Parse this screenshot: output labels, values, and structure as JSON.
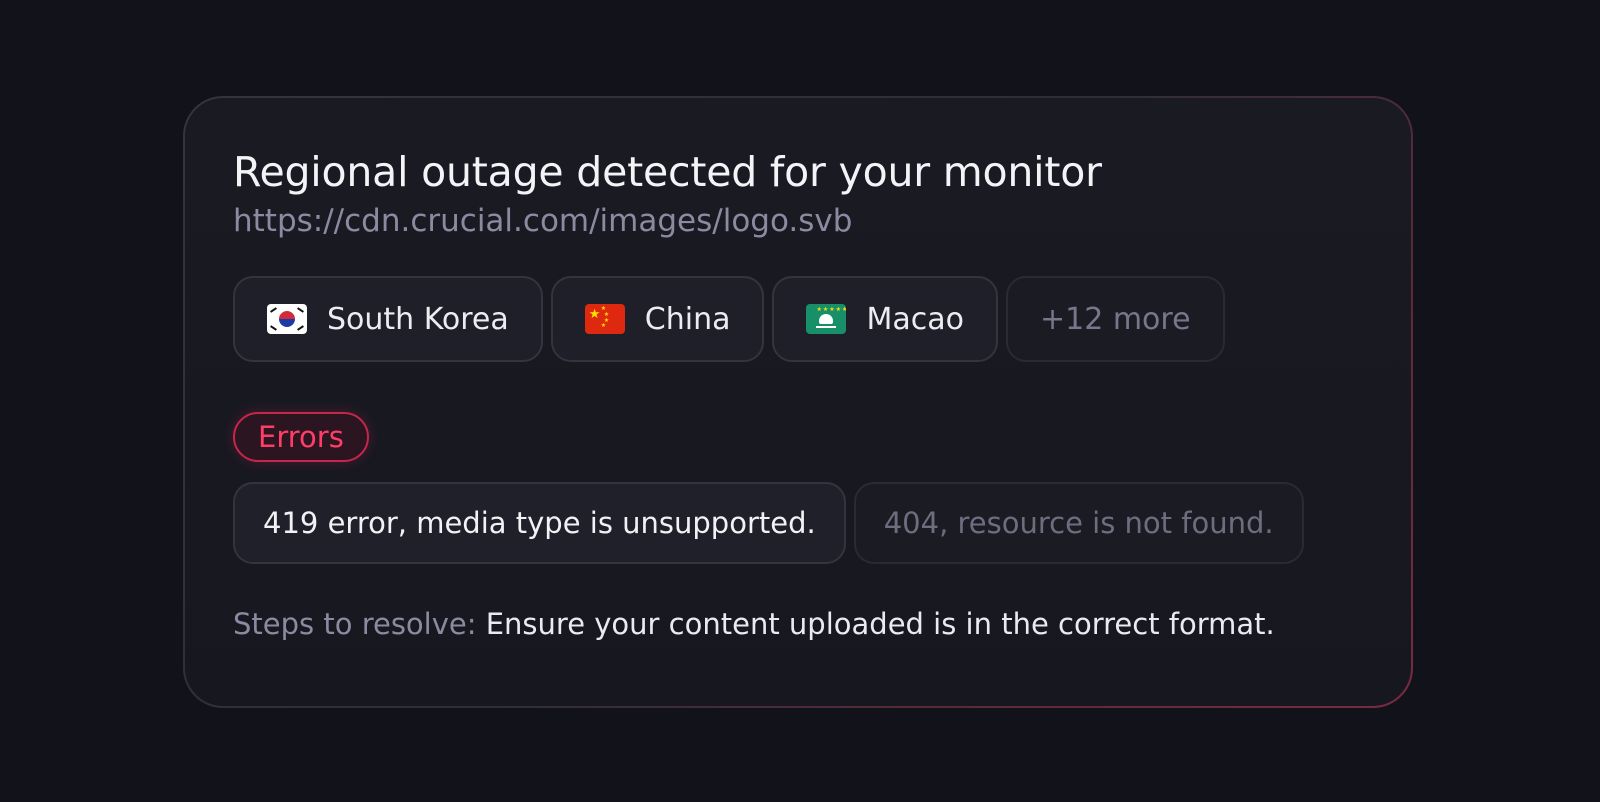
{
  "alert": {
    "title": "Regional outage detected for your monitor",
    "url": "https://cdn.crucial.com/images/logo.svb"
  },
  "regions": [
    {
      "label": "South Korea",
      "flag": "south-korea-flag"
    },
    {
      "label": "China",
      "flag": "china-flag"
    },
    {
      "label": "Macao",
      "flag": "macao-flag"
    }
  ],
  "more_regions": "+12 more",
  "errors": {
    "badge": "Errors",
    "items": [
      "419 error, media type is unsupported.",
      "404, resource is not found."
    ]
  },
  "resolution": {
    "label": "Steps to resolve:",
    "text": "Ensure your content uploaded is in the correct format."
  },
  "colors": {
    "background": "#12121a",
    "card": "#1a1a23",
    "error_accent": "#ff3d67",
    "muted_text": "#8b8aa0"
  }
}
